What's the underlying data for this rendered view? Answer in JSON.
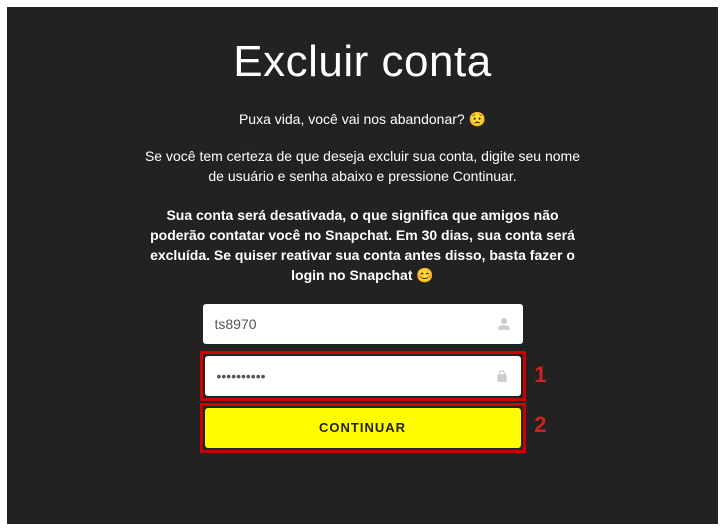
{
  "title": "Excluir conta",
  "subtitle_text": "Puxa vida, você vai nos abandonar? ",
  "subtitle_emoji": "😟",
  "para1": "Se você tem certeza de que deseja excluir sua conta, digite seu nome de usuário e senha abaixo e pressione Continuar.",
  "para2_text": "Sua conta será desativada, o que significa que amigos não poderão contatar você no Snapchat. Em 30 dias, sua conta será excluída. Se quiser reativar sua conta antes disso, basta fazer o login no Snapchat ",
  "para2_emoji": "😊",
  "form": {
    "username_value": "ts8970",
    "password_value": "••••••••••",
    "continue_label": "CONTINUAR"
  },
  "annotations": {
    "one": "1",
    "two": "2"
  }
}
